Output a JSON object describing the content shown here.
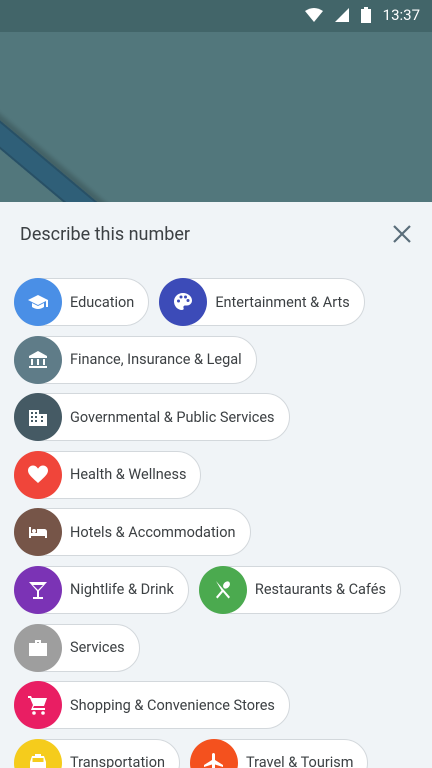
{
  "status_bar": {
    "time": "13:37"
  },
  "sheet": {
    "title": "Describe this number"
  },
  "categories": [
    [
      {
        "label": "Education",
        "color": "#4a8fe6",
        "icon": "graduation-cap-icon"
      },
      {
        "label": "Entertainment & Arts",
        "color": "#3c4bb8",
        "icon": "palette-icon"
      }
    ],
    [
      {
        "label": "Finance, Insurance & Legal",
        "color": "#5f7c88",
        "icon": "bank-icon"
      }
    ],
    [
      {
        "label": "Governmental & Public Services",
        "color": "#455a64",
        "icon": "building-icon"
      }
    ],
    [
      {
        "label": "Health & Wellness",
        "color": "#f0453a",
        "icon": "heart-icon"
      }
    ],
    [
      {
        "label": "Hotels & Accommodation",
        "color": "#765548",
        "icon": "bed-icon"
      }
    ],
    [
      {
        "label": "Nightlife & Drink",
        "color": "#7b33b5",
        "icon": "cocktail-icon"
      },
      {
        "label": "Restaurants & Cafés",
        "color": "#4baa4f",
        "icon": "fork-spoon-icon"
      }
    ],
    [
      {
        "label": "Services",
        "color": "#9e9e9e",
        "icon": "briefcase-icon"
      }
    ],
    [
      {
        "label": "Shopping & Convenience Stores",
        "color": "#e91e63",
        "icon": "cart-icon"
      }
    ],
    [
      {
        "label": "Transportation",
        "color": "#f5cc1c",
        "icon": "taxi-icon"
      },
      {
        "label": "Travel & Tourism",
        "color": "#f4511e",
        "icon": "airplane-icon"
      }
    ]
  ]
}
